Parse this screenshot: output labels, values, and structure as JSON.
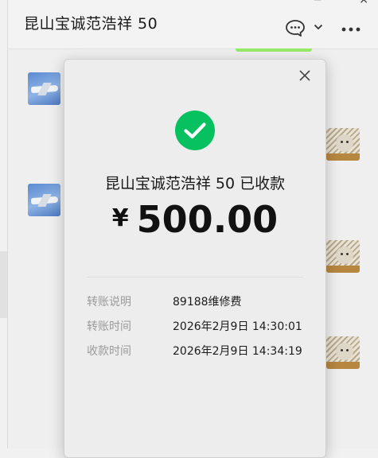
{
  "chat": {
    "title": "昆山宝诚范浩祥  50",
    "window_min": "−",
    "window_close": "×"
  },
  "icons": {
    "chat": "speech-bubble-icon",
    "dropdown": "chevron-down-icon",
    "more": "more-horizontal-icon",
    "close": "close-icon",
    "success": "check-circle-icon"
  },
  "colors": {
    "success_green": "#07c160",
    "accent_green": "#95ec69"
  },
  "receipt": {
    "status_text": "昆山宝诚范浩祥  50 已收款",
    "currency": "¥",
    "amount": "500.00",
    "fields": [
      {
        "label": "转账说明",
        "value": "89188维修费"
      },
      {
        "label": "转账时间",
        "value": "2026年2月9日 14:30:01"
      },
      {
        "label": "收款时间",
        "value": "2026年2月9日 14:34:19"
      }
    ]
  }
}
